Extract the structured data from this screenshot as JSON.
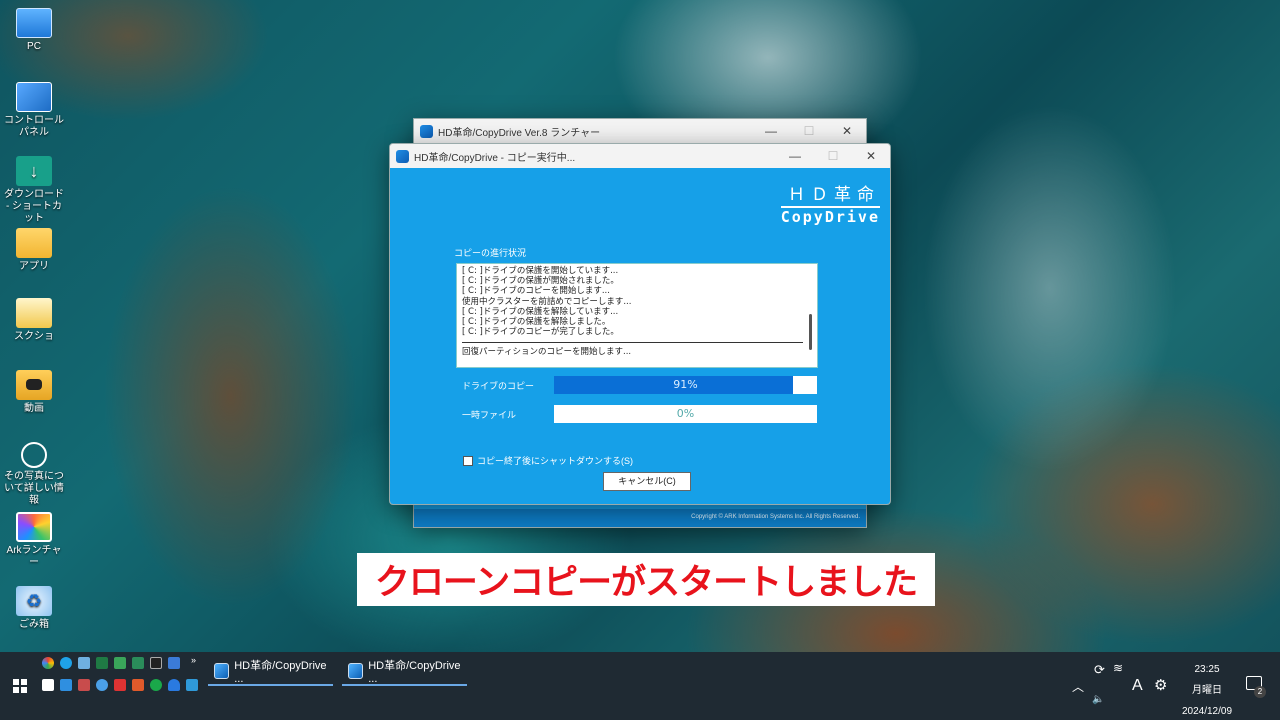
{
  "desktop": {
    "icons": [
      {
        "label": "PC",
        "icon": "pc-icon"
      },
      {
        "label": "コントロールパネル",
        "icon": "control-panel-icon"
      },
      {
        "label": "ダウンロード - ショートカット",
        "icon": "download-shortcut-icon"
      },
      {
        "label": "アプリ",
        "icon": "folder-icon"
      },
      {
        "label": "スクショ",
        "icon": "folder-icon"
      },
      {
        "label": "動画",
        "icon": "video-folder-icon"
      },
      {
        "label": "その写真について詳しい情報",
        "icon": "update-icon"
      },
      {
        "label": "Arkランチャー",
        "icon": "ark-launcher-icon"
      },
      {
        "label": "ごみ箱",
        "icon": "recycle-bin-icon"
      }
    ]
  },
  "launcher_window": {
    "title": "HD革命/CopyDrive Ver.8 ランチャー",
    "footer": "Copyright © ARK Information Systems Inc. All Rights Reserved."
  },
  "copy_window": {
    "title": "HD革命/CopyDrive - コピー実行中...",
    "logo_top": "ＨＤ革命",
    "logo_bottom": "CopyDrive",
    "progress_section_label": "コピーの進行状況",
    "log_lines": [
      "[ C: ]ドライブの保護を開始しています...",
      "[ C: ]ドライブの保護が開始されました。",
      "[ C: ]ドライブのコピーを開始します...",
      "使用中クラスターを前詰めでコピーします...",
      "[ C: ]ドライブの保護を解除しています...",
      "[ C: ]ドライブの保護を解除しました。",
      "[ C: ]ドライブのコピーが完了しました。"
    ],
    "log_last_line": "回復パーティションのコピーを開始します...",
    "drive_copy": {
      "label": "ドライブのコピー",
      "percent_text": "91%",
      "fraction": 0.91
    },
    "temp_file": {
      "label": "一時ファイル",
      "percent_text": "0%",
      "fraction": 0.0
    },
    "shutdown_checkbox_label": "コピー終了後にシャットダウンする(S)",
    "shutdown_checked": false,
    "cancel_label": "キャンセル(C)"
  },
  "caption": "クローンコピーがスタートしました",
  "taskbar": {
    "buttons": [
      {
        "label": "HD革命/CopyDrive ..."
      },
      {
        "label": "HD革命/CopyDrive ..."
      }
    ],
    "ime": "A",
    "time": "23:25",
    "day": "月曜日",
    "date": "2024/12/09",
    "notification_count": "2",
    "more_symbol": "»"
  },
  "colors": {
    "app_blue": "#16a0e8",
    "progress_fill": "#0a6fd6",
    "caption_red": "#e8131c",
    "taskbar_bg": "#1f2a33"
  }
}
